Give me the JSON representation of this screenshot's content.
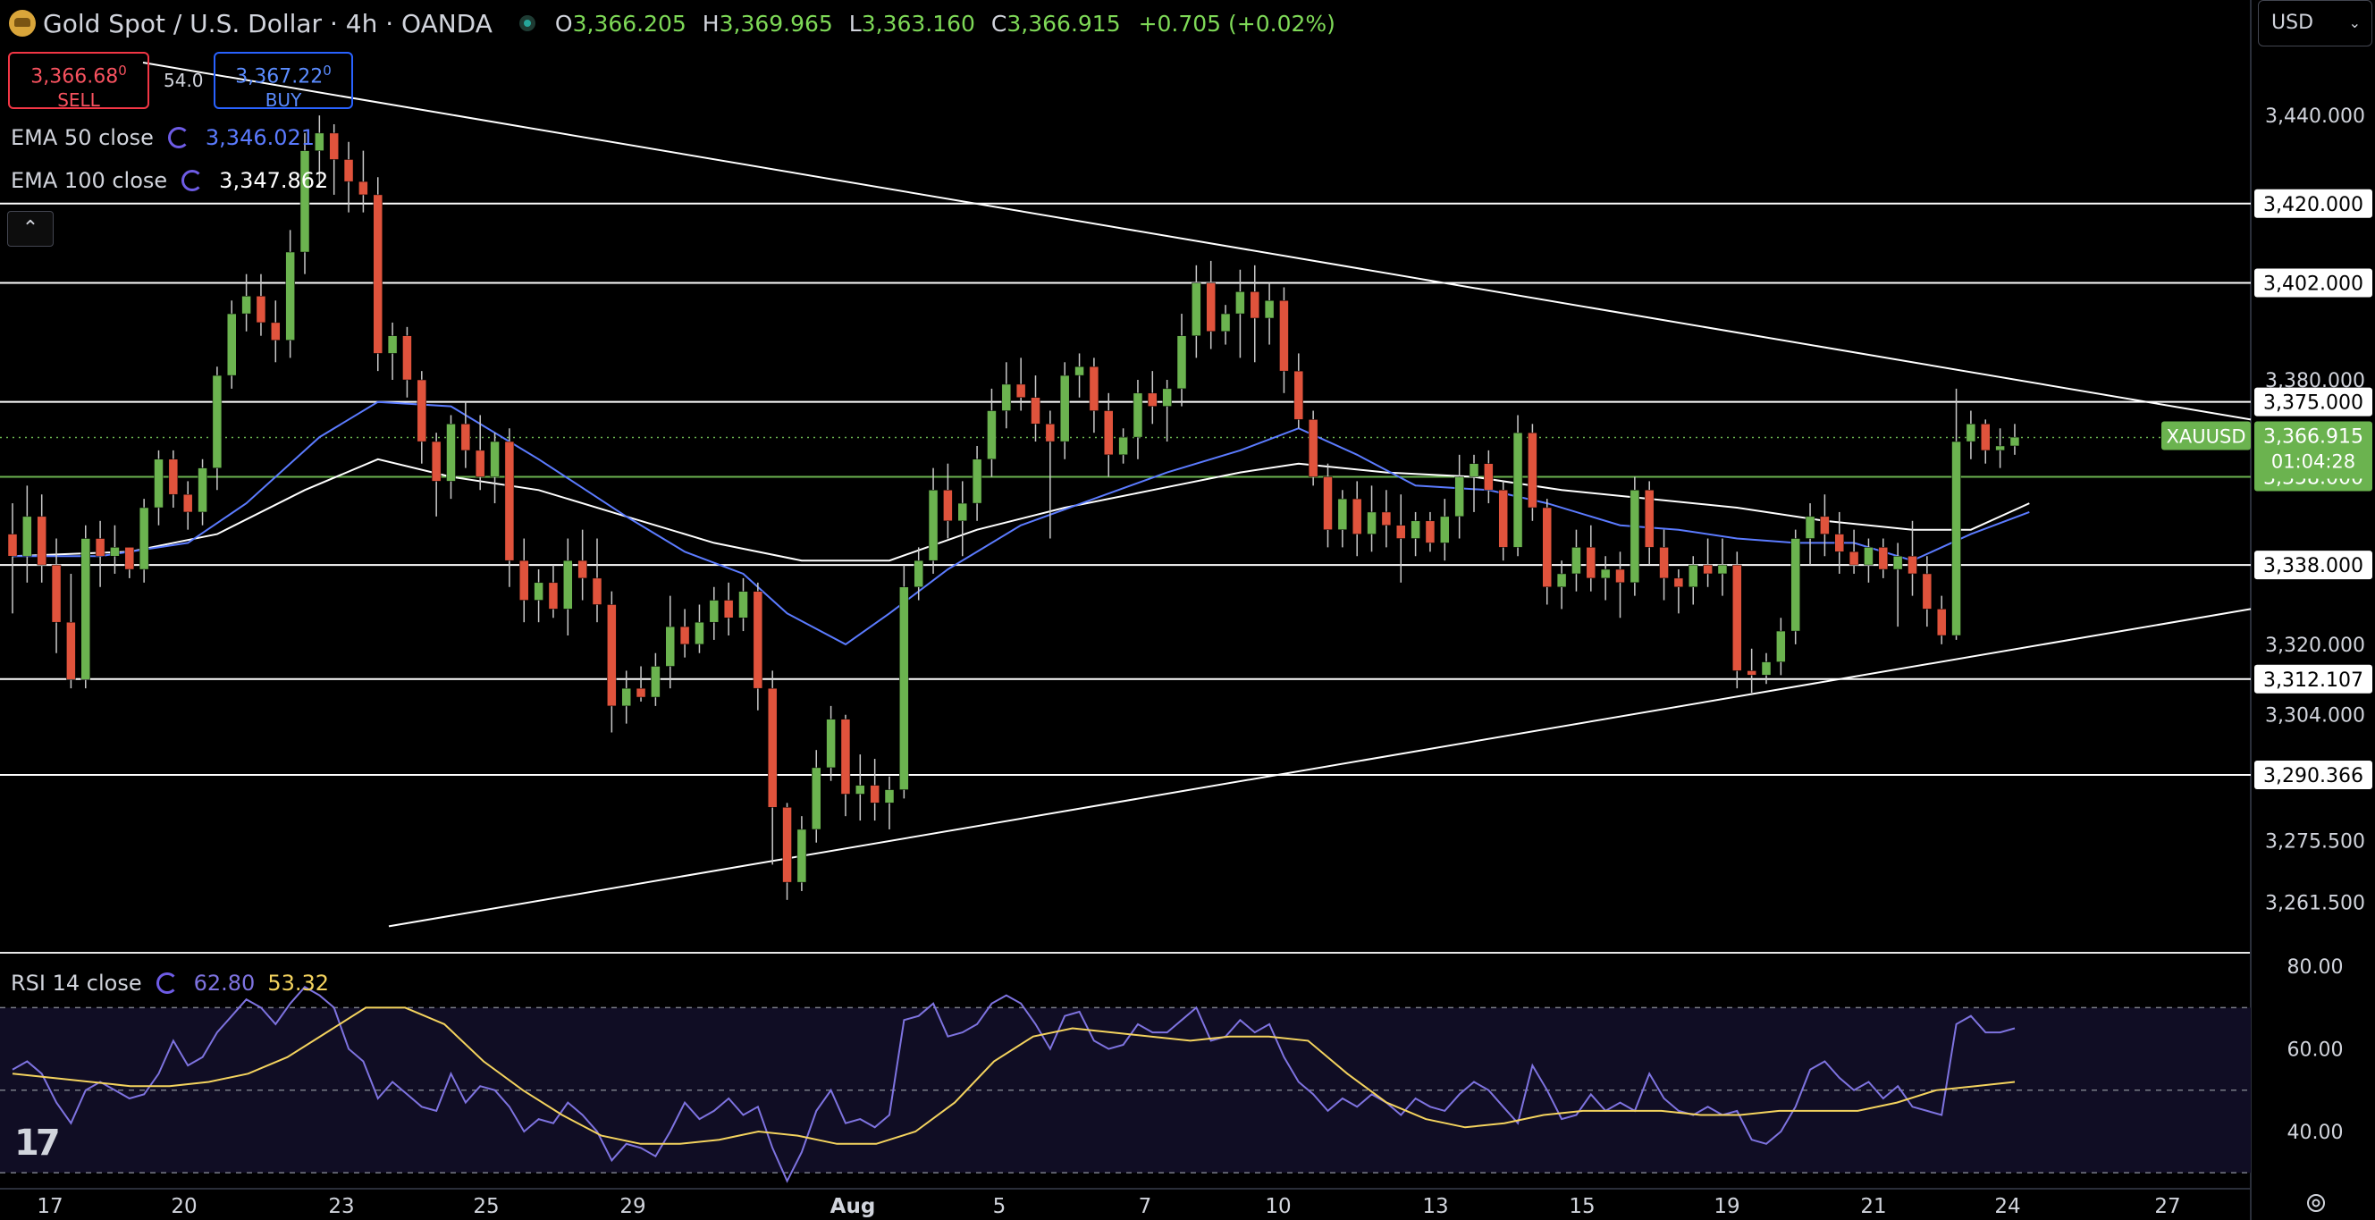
{
  "header": {
    "title": "Gold Spot / U.S. Dollar · 4h · OANDA",
    "ohlc": {
      "o_label": "O",
      "o": "3,366.205",
      "h_label": "H",
      "h": "3,369.965",
      "l_label": "L",
      "l": "3,363.160",
      "c_label": "C",
      "c": "3,366.915",
      "change": "+0.705 (+0.02%)"
    }
  },
  "trade": {
    "sell_price": "3,366.68",
    "sell_sup": "0",
    "sell_label": "SELL",
    "spread": "54.0",
    "buy_price": "3,367.22",
    "buy_sup": "0",
    "buy_label": "BUY"
  },
  "indicators": {
    "ema50": {
      "label": "EMA 50 close",
      "value": "3,346.021",
      "color": "#5b7bff"
    },
    "ema100": {
      "label": "EMA 100 close",
      "value": "3,347.862",
      "color": "#ffffff"
    },
    "rsi": {
      "label": "RSI 14 close",
      "value": "62.80",
      "ma_value": "53.32",
      "color": "#7e73e0",
      "ma_color": "#f4d35e"
    }
  },
  "currency": "USD",
  "symbol_tag": "XAUUSD",
  "countdown": "01:04:28",
  "collapse_icon": "chevron-up-icon",
  "colors": {
    "up": "#6bb34f",
    "down": "#e0533c",
    "wick": "#c8c8c8",
    "level": "#ffffff",
    "last": "#6bb34f"
  },
  "chart_data": {
    "type": "candlestick",
    "timeframe": "4h",
    "ylim": [
      3250,
      3452
    ],
    "y_ticks": [
      3440.0,
      3380.0,
      3320.0,
      3304.0,
      3275.5,
      3261.5
    ],
    "x_ticks": [
      "17",
      "20",
      "23",
      "25",
      "29",
      "Aug",
      "5",
      "7",
      "10",
      "13",
      "15",
      "19",
      "21",
      "24",
      "27"
    ],
    "levels": [
      3420.0,
      3402.0,
      3375.0,
      3338.0,
      3312.107,
      3290.366
    ],
    "last_price": 3366.915,
    "green_level": 3358.0,
    "trendlines": [
      {
        "name": "upper",
        "from": {
          "bar": 0,
          "price": 3452
        },
        "to": {
          "bar": 148,
          "price": 3371
        }
      },
      {
        "name": "lower",
        "from": {
          "bar": 14,
          "price": 3256
        },
        "to": {
          "bar": 148,
          "price": 3328
        }
      }
    ],
    "candles": [
      [
        3345,
        3352,
        3327,
        3340
      ],
      [
        3340,
        3356,
        3334,
        3349
      ],
      [
        3349,
        3354,
        3334,
        3338
      ],
      [
        3338,
        3344,
        3318,
        3325
      ],
      [
        3325,
        3336,
        3310,
        3312
      ],
      [
        3312,
        3347,
        3310,
        3344
      ],
      [
        3344,
        3348,
        3333,
        3340
      ],
      [
        3340,
        3347,
        3336,
        3342
      ],
      [
        3342,
        3342,
        3335,
        3337
      ],
      [
        3337,
        3353,
        3334,
        3351
      ],
      [
        3351,
        3364,
        3347,
        3362
      ],
      [
        3362,
        3364,
        3351,
        3354
      ],
      [
        3354,
        3357,
        3346,
        3350
      ],
      [
        3350,
        3362,
        3347,
        3360
      ],
      [
        3360,
        3383,
        3355,
        3381
      ],
      [
        3381,
        3398,
        3378,
        3395
      ],
      [
        3395,
        3404,
        3391,
        3399
      ],
      [
        3399,
        3404,
        3390,
        3393
      ],
      [
        3393,
        3398,
        3384,
        3389
      ],
      [
        3389,
        3414,
        3385,
        3409
      ],
      [
        3409,
        3436,
        3404,
        3432
      ],
      [
        3432,
        3440,
        3424,
        3436
      ],
      [
        3436,
        3438,
        3422,
        3430
      ],
      [
        3430,
        3434,
        3418,
        3425
      ],
      [
        3425,
        3432,
        3418,
        3422
      ],
      [
        3422,
        3426,
        3382,
        3386
      ],
      [
        3386,
        3393,
        3380,
        3390
      ],
      [
        3390,
        3392,
        3376,
        3380
      ],
      [
        3380,
        3382,
        3361,
        3366
      ],
      [
        3366,
        3368,
        3349,
        3357
      ],
      [
        3357,
        3372,
        3353,
        3370
      ],
      [
        3370,
        3375,
        3360,
        3364
      ],
      [
        3364,
        3372,
        3355,
        3358
      ],
      [
        3358,
        3368,
        3352,
        3366
      ],
      [
        3366,
        3369,
        3333,
        3339
      ],
      [
        3339,
        3344,
        3325,
        3330
      ],
      [
        3330,
        3337,
        3325,
        3334
      ],
      [
        3334,
        3338,
        3326,
        3328
      ],
      [
        3328,
        3344,
        3322,
        3339
      ],
      [
        3339,
        3346,
        3330,
        3335
      ],
      [
        3335,
        3344,
        3325,
        3329
      ],
      [
        3329,
        3332,
        3300,
        3306
      ],
      [
        3306,
        3314,
        3302,
        3310
      ],
      [
        3310,
        3315,
        3307,
        3308
      ],
      [
        3308,
        3318,
        3306,
        3315
      ],
      [
        3315,
        3331,
        3310,
        3324
      ],
      [
        3324,
        3328,
        3317,
        3320
      ],
      [
        3320,
        3329,
        3318,
        3325
      ],
      [
        3325,
        3333,
        3321,
        3330
      ],
      [
        3330,
        3334,
        3322,
        3326
      ],
      [
        3326,
        3335,
        3323,
        3332
      ],
      [
        3332,
        3334,
        3305,
        3310
      ],
      [
        3310,
        3314,
        3270,
        3283
      ],
      [
        3283,
        3284,
        3262,
        3266
      ],
      [
        3266,
        3281,
        3264,
        3278
      ],
      [
        3278,
        3296,
        3275,
        3292
      ],
      [
        3292,
        3306,
        3289,
        3303
      ],
      [
        3303,
        3304,
        3281,
        3286
      ],
      [
        3286,
        3295,
        3280,
        3288
      ],
      [
        3288,
        3294,
        3280,
        3284
      ],
      [
        3284,
        3290,
        3278,
        3287
      ],
      [
        3287,
        3338,
        3285,
        3333
      ],
      [
        3333,
        3342,
        3330,
        3339
      ],
      [
        3339,
        3360,
        3336,
        3355
      ],
      [
        3355,
        3361,
        3344,
        3348
      ],
      [
        3348,
        3357,
        3340,
        3352
      ],
      [
        3352,
        3365,
        3348,
        3362
      ],
      [
        3362,
        3378,
        3358,
        3373
      ],
      [
        3373,
        3384,
        3369,
        3379
      ],
      [
        3379,
        3385,
        3373,
        3376
      ],
      [
        3376,
        3381,
        3366,
        3370
      ],
      [
        3370,
        3373,
        3344,
        3366
      ],
      [
        3366,
        3384,
        3362,
        3381
      ],
      [
        3381,
        3386,
        3376,
        3383
      ],
      [
        3383,
        3385,
        3368,
        3373
      ],
      [
        3373,
        3377,
        3358,
        3363
      ],
      [
        3363,
        3369,
        3361,
        3367
      ],
      [
        3367,
        3380,
        3362,
        3377
      ],
      [
        3377,
        3382,
        3370,
        3374
      ],
      [
        3374,
        3380,
        3366,
        3378
      ],
      [
        3378,
        3395,
        3374,
        3390
      ],
      [
        3390,
        3406,
        3385,
        3402
      ],
      [
        3402,
        3407,
        3387,
        3391
      ],
      [
        3391,
        3397,
        3388,
        3395
      ],
      [
        3395,
        3405,
        3385,
        3400
      ],
      [
        3400,
        3406,
        3384,
        3394
      ],
      [
        3394,
        3402,
        3388,
        3398
      ],
      [
        3398,
        3401,
        3377,
        3382
      ],
      [
        3382,
        3386,
        3369,
        3371
      ],
      [
        3371,
        3373,
        3356,
        3358
      ],
      [
        3358,
        3361,
        3342,
        3346
      ],
      [
        3346,
        3355,
        3342,
        3353
      ],
      [
        3353,
        3357,
        3340,
        3345
      ],
      [
        3345,
        3356,
        3341,
        3350
      ],
      [
        3350,
        3355,
        3342,
        3347
      ],
      [
        3347,
        3354,
        3334,
        3344
      ],
      [
        3344,
        3350,
        3340,
        3348
      ],
      [
        3348,
        3350,
        3341,
        3343
      ],
      [
        3343,
        3353,
        3339,
        3349
      ],
      [
        3349,
        3363,
        3344,
        3358
      ],
      [
        3358,
        3363,
        3350,
        3361
      ],
      [
        3361,
        3364,
        3352,
        3355
      ],
      [
        3355,
        3357,
        3339,
        3342
      ],
      [
        3342,
        3372,
        3340,
        3368
      ],
      [
        3368,
        3370,
        3348,
        3351
      ],
      [
        3351,
        3353,
        3329,
        3333
      ],
      [
        3333,
        3339,
        3328,
        3336
      ],
      [
        3336,
        3346,
        3332,
        3342
      ],
      [
        3342,
        3347,
        3332,
        3335
      ],
      [
        3335,
        3340,
        3330,
        3337
      ],
      [
        3337,
        3341,
        3326,
        3334
      ],
      [
        3334,
        3358,
        3331,
        3355
      ],
      [
        3355,
        3357,
        3338,
        3342
      ],
      [
        3342,
        3346,
        3330,
        3335
      ],
      [
        3335,
        3337,
        3327,
        3333
      ],
      [
        3333,
        3340,
        3329,
        3338
      ],
      [
        3338,
        3344,
        3333,
        3336
      ],
      [
        3336,
        3344,
        3331,
        3338
      ],
      [
        3338,
        3341,
        3310,
        3314
      ],
      [
        3314,
        3319,
        3309,
        3313
      ],
      [
        3313,
        3318,
        3311,
        3316
      ],
      [
        3316,
        3326,
        3313,
        3323
      ],
      [
        3323,
        3346,
        3320,
        3344
      ],
      [
        3344,
        3352,
        3338,
        3349
      ],
      [
        3349,
        3354,
        3340,
        3345
      ],
      [
        3345,
        3350,
        3336,
        3341
      ],
      [
        3341,
        3346,
        3336,
        3338
      ],
      [
        3338,
        3344,
        3334,
        3342
      ],
      [
        3342,
        3344,
        3335,
        3337
      ],
      [
        3337,
        3343,
        3324,
        3340
      ],
      [
        3340,
        3348,
        3331,
        3336
      ],
      [
        3336,
        3340,
        3324,
        3328
      ],
      [
        3328,
        3331,
        3320,
        3322
      ],
      [
        3322,
        3378,
        3321,
        3366
      ],
      [
        3366,
        3373,
        3362,
        3370
      ],
      [
        3370,
        3371,
        3361,
        3364
      ],
      [
        3364,
        3369,
        3360,
        3365
      ],
      [
        3365,
        3370,
        3363,
        3367
      ]
    ],
    "ema50": [
      [
        0,
        3340
      ],
      [
        6,
        3340
      ],
      [
        12,
        3343
      ],
      [
        16,
        3352
      ],
      [
        21,
        3367
      ],
      [
        25,
        3375
      ],
      [
        30,
        3374
      ],
      [
        36,
        3362
      ],
      [
        42,
        3349
      ],
      [
        46,
        3341
      ],
      [
        50,
        3336
      ],
      [
        53,
        3327
      ],
      [
        57,
        3320
      ],
      [
        60,
        3327
      ],
      [
        64,
        3337
      ],
      [
        69,
        3347
      ],
      [
        74,
        3353
      ],
      [
        79,
        3359
      ],
      [
        84,
        3364
      ],
      [
        88,
        3369
      ],
      [
        92,
        3363
      ],
      [
        96,
        3356
      ],
      [
        101,
        3355
      ],
      [
        105,
        3352
      ],
      [
        110,
        3347
      ],
      [
        114,
        3346
      ],
      [
        118,
        3344
      ],
      [
        122,
        3343
      ],
      [
        126,
        3343
      ],
      [
        130,
        3339
      ],
      [
        134,
        3345
      ],
      [
        138,
        3350
      ]
    ],
    "ema100": [
      [
        0,
        3340
      ],
      [
        8,
        3341
      ],
      [
        14,
        3345
      ],
      [
        20,
        3355
      ],
      [
        25,
        3362
      ],
      [
        30,
        3358
      ],
      [
        36,
        3355
      ],
      [
        42,
        3349
      ],
      [
        48,
        3343
      ],
      [
        54,
        3339
      ],
      [
        60,
        3339
      ],
      [
        66,
        3346
      ],
      [
        72,
        3351
      ],
      [
        78,
        3355
      ],
      [
        84,
        3359
      ],
      [
        88,
        3361
      ],
      [
        94,
        3359
      ],
      [
        100,
        3358
      ],
      [
        106,
        3355
      ],
      [
        112,
        3353
      ],
      [
        118,
        3351
      ],
      [
        124,
        3348
      ],
      [
        130,
        3346
      ],
      [
        134,
        3346
      ],
      [
        138,
        3352
      ]
    ],
    "rsi": {
      "ylim": [
        27,
        82
      ],
      "ticks": [
        80,
        60,
        40
      ],
      "upper_band": 70,
      "lower_band": 30,
      "mid": 50,
      "values": [
        55,
        57,
        54,
        47,
        42,
        50,
        52,
        50,
        48,
        49,
        54,
        62,
        56,
        58,
        64,
        68,
        72,
        70,
        66,
        71,
        75,
        73,
        70,
        60,
        57,
        48,
        52,
        49,
        46,
        45,
        54,
        47,
        51,
        50,
        46,
        40,
        43,
        42,
        47,
        44,
        40,
        33,
        37,
        36,
        34,
        40,
        47,
        43,
        45,
        48,
        44,
        46,
        36,
        28,
        35,
        45,
        50,
        42,
        43,
        41,
        44,
        67,
        68,
        71,
        63,
        64,
        66,
        71,
        73,
        71,
        66,
        60,
        68,
        69,
        62,
        60,
        61,
        66,
        64,
        64,
        67,
        70,
        62,
        63,
        67,
        64,
        66,
        58,
        52,
        49,
        45,
        48,
        46,
        49,
        47,
        44,
        48,
        46,
        45,
        49,
        52,
        50,
        46,
        42,
        56,
        50,
        43,
        44,
        49,
        45,
        47,
        45,
        54,
        48,
        45,
        44,
        46,
        44,
        45,
        38,
        37,
        40,
        46,
        55,
        57,
        53,
        50,
        52,
        48,
        51,
        46,
        45,
        44,
        66,
        68,
        64,
        64,
        65
      ],
      "ma_values": [
        54,
        53,
        52,
        51,
        51,
        52,
        54,
        58,
        64,
        70,
        70,
        66,
        57,
        50,
        44,
        39,
        37,
        37,
        38,
        40,
        39,
        37,
        37,
        40,
        47,
        57,
        63,
        65,
        64,
        63,
        62,
        63,
        63,
        62,
        54,
        47,
        43,
        41,
        42,
        44,
        45,
        45,
        45,
        44,
        44,
        45,
        45,
        45,
        47,
        50,
        51,
        52
      ]
    }
  }
}
